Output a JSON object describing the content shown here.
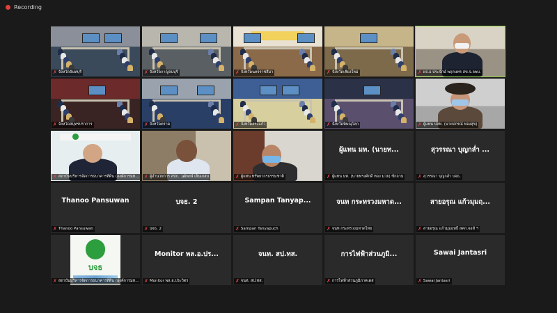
{
  "recording": {
    "label": "Recording"
  },
  "tiles": [
    {
      "type": "video",
      "scene": "room-a",
      "name": "จังหวัดจันทบุรี"
    },
    {
      "type": "video",
      "scene": "room-b",
      "name": "จังหวัดกาญจนบุรี"
    },
    {
      "type": "video",
      "scene": "room-c",
      "name": "จังหวัดนครราชสีมา"
    },
    {
      "type": "video",
      "scene": "room-d",
      "name": "จังหวัดเชียงใหม่"
    },
    {
      "type": "video",
      "scene": "person-mask",
      "name": "ผจ.อ.ประจักษ์ พฤกษทร สข.จ.ลพบ.",
      "active": true
    },
    {
      "type": "video",
      "scene": "room-e",
      "name": "จังหวัดสมุทรปราการ"
    },
    {
      "type": "video",
      "scene": "room-f",
      "name": "จังหวัดตราด"
    },
    {
      "type": "video",
      "scene": "room-g",
      "name": "จังหวัดสระแก้ว"
    },
    {
      "type": "video",
      "scene": "room-h",
      "name": "จังหวัดพิษณุโลก"
    },
    {
      "type": "video",
      "scene": "person-hat",
      "name": "ผู้แทน ปสท. (นายปกรณ์ ทองสุข)"
    },
    {
      "type": "video",
      "scene": "logo-man",
      "name": "สถาบันบริหารจัดการธนาคารที่ดิน (องค์การมหาชน)"
    },
    {
      "type": "video",
      "scene": "man-phone",
      "name": "ผู้อำนวยการ สปก. วุฒิพงษ์ เย็นเกลบ"
    },
    {
      "type": "video",
      "scene": "man-masked",
      "name": "ผู้แทน ทรัพยากรธรรมชาติ"
    },
    {
      "type": "placeholder",
      "label": "ผู้แทน มท. (นายท...",
      "name": "ผู้แทน มท. (นายทรงศักดิ์ ทอง มวย) ซักถาม"
    },
    {
      "type": "placeholder",
      "label": "สุวรรณา บุญกล่ำ ...",
      "name": "สุวรรณา บุญกล่ำ บจธ."
    },
    {
      "type": "placeholder",
      "label": "Thanoo Pansuwan",
      "name": "Thanoo Pansuwan"
    },
    {
      "type": "placeholder",
      "label": "บจธ. 2",
      "name": "บจธ. 2"
    },
    {
      "type": "placeholder",
      "label": "Sampan Tanyap...",
      "name": "Sampan Tanyapuch"
    },
    {
      "type": "placeholder",
      "label": "จนท กระทรวงมหาด...",
      "name": "จนท กระทรวงมหาดไทย"
    },
    {
      "type": "placeholder",
      "label": "สายอรุณ แก้วมุมฤ...",
      "name": "สายอรุณ แก้วมุมฤทธิ์ สคก.จอห้ ฯ"
    },
    {
      "type": "video",
      "scene": "logo-bjr",
      "name": "สถาบันบริหารจัดการธนาคารที่ดิน (องค์การมหาชน)",
      "logo_text": "บจธ"
    },
    {
      "type": "placeholder",
      "label": "Monitor พล.อ.ปร...",
      "name": "Monitor พล.อ.ประวิตร"
    },
    {
      "type": "placeholder",
      "label": "จนท. สป.ทส.",
      "name": "จนท. สป.ทส."
    },
    {
      "type": "placeholder",
      "label": "การไฟฟ้าส่วนภูมิ...",
      "name": "การไฟฟ้าส่วนภูมิภาคเดส"
    },
    {
      "type": "placeholder",
      "label": "Sawai Jantasri",
      "name": "Sawai Jantasri"
    }
  ]
}
